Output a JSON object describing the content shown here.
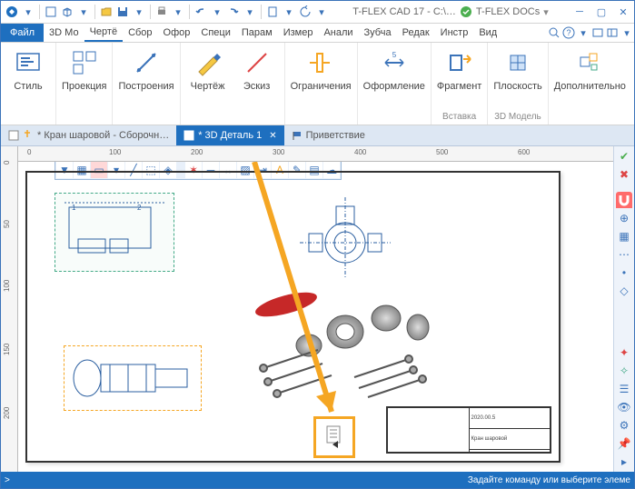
{
  "titlebar": {
    "app_title": "T-FLEX CAD 17 - C:\\…",
    "docs_label": "T-FLEX DOCs"
  },
  "menu": {
    "file": "Файл",
    "items": [
      "3D Мо",
      "Чертё",
      "Сбор",
      "Офор",
      "Специ",
      "Парам",
      "Измер",
      "Анали",
      "Зубча",
      "Редак",
      "Инстр",
      "Вид"
    ]
  },
  "ribbon": {
    "style": "Стиль",
    "projection": "Проекция",
    "constructions": "Построения",
    "drawing": "Чертёж",
    "sketch": "Эскиз",
    "constraints": "Ограничения",
    "formatting": "Оформление",
    "fragment": "Фрагмент",
    "plane": "Плоскость",
    "additional": "Дополнительно",
    "group_insert": "Вставка",
    "group_3dmodel": "3D Модель"
  },
  "tabs": {
    "t1": "* Кран шаровой - Сборочн…",
    "t2": "* 3D Деталь 1",
    "t3": "Приветствие"
  },
  "ruler_h": [
    "0",
    "100",
    "200",
    "300",
    "400",
    "500",
    "600"
  ],
  "ruler_v": [
    "0",
    "50",
    "100",
    "150",
    "200"
  ],
  "status": {
    "prompt": "Задайте команду или выберите элеме"
  },
  "titleblock": {
    "r1": "Кран шаровой",
    "r2": "2020.00.5"
  }
}
